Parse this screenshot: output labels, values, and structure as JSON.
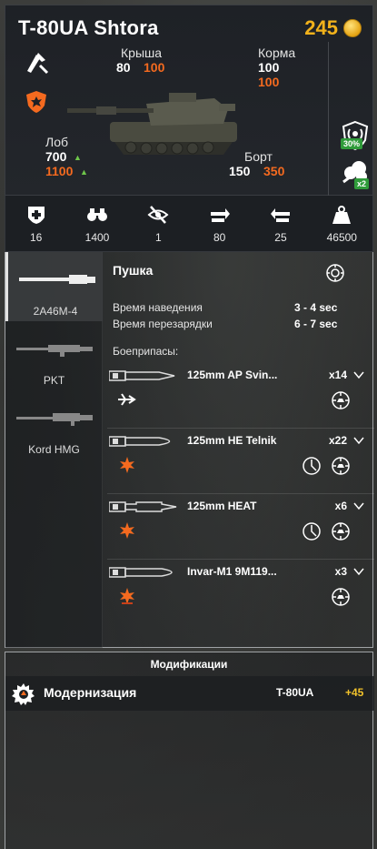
{
  "header": {
    "tank_name": "T-80UA Shtora",
    "gold": "245",
    "armor": {
      "roof_label": "Крыша",
      "roof_base": "80",
      "roof_ext": "100",
      "rear_label": "Корма",
      "rear_base": "100",
      "rear_ext": "100",
      "front_label": "Лоб",
      "front_base": "700",
      "front_ext": "1100",
      "side_label": "Борт",
      "side_base": "150",
      "side_ext": "350"
    },
    "badges": {
      "camo_pct": "30%",
      "smoke_count": "x2"
    },
    "colors": {
      "gold": "#f2b21b",
      "armor_ext": "#f46a1f",
      "badge_green": "#2f9b3a"
    }
  },
  "stats": [
    {
      "icon": "health-cross-icon",
      "value": "16"
    },
    {
      "icon": "binoculars-icon",
      "value": "1400"
    },
    {
      "icon": "crossed-eye-icon",
      "value": "1"
    },
    {
      "icon": "forward-speed-icon",
      "value": "80"
    },
    {
      "icon": "reverse-speed-icon",
      "value": "25"
    },
    {
      "icon": "weight-icon",
      "value": "46500"
    }
  ],
  "weapons": {
    "tabs": [
      {
        "name": "2A46M-4"
      },
      {
        "name": "PKT"
      },
      {
        "name": "Kord HMG"
      }
    ],
    "section_title": "Пушка",
    "aim_label": "Время наведения",
    "aim_value": "3 - 4 sec",
    "reload_label": "Время перезарядки",
    "reload_value": "6 - 7 sec",
    "ammo_title": "Боеприпасы:",
    "shells": [
      {
        "name": "125mm AP Svin...",
        "count": "x14"
      },
      {
        "name": "125mm HE Telnik",
        "count": "x22"
      },
      {
        "name": "125mm HEAT",
        "count": "x6"
      },
      {
        "name": "Invar-M1 9M119...",
        "count": "x3"
      }
    ]
  },
  "mods": {
    "title": "Модификации",
    "name": "Модернизация",
    "tank": "T-80UA",
    "value": "+45"
  }
}
